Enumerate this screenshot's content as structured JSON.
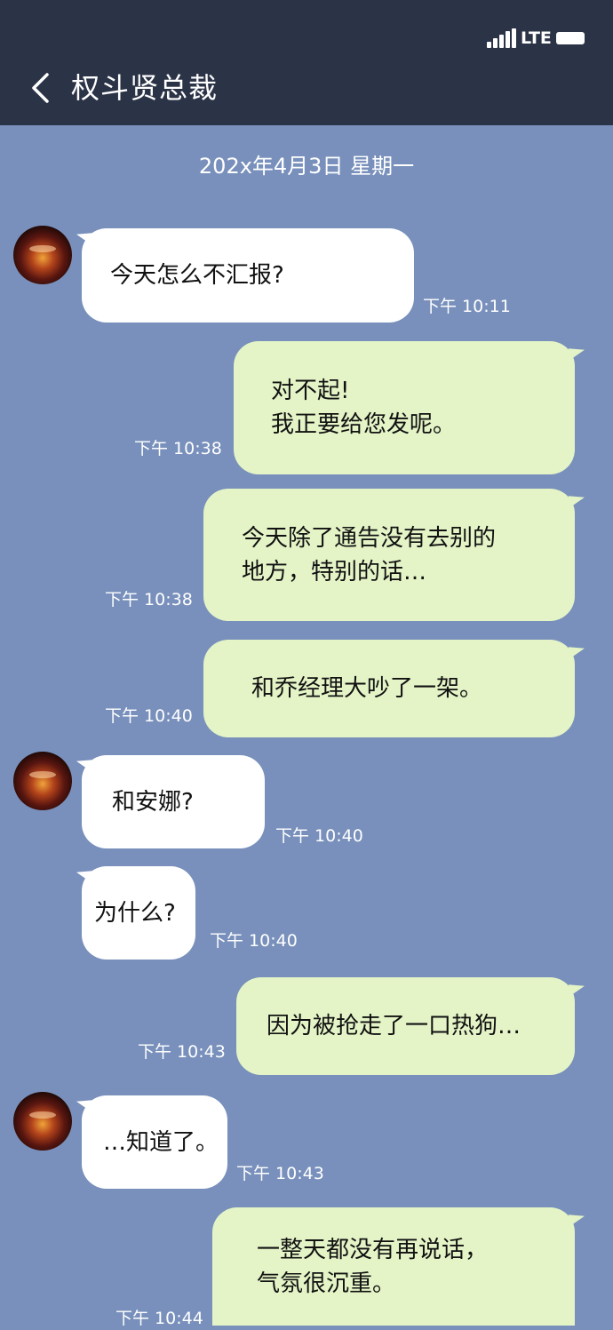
{
  "status_bar": {
    "network": "LTE"
  },
  "header": {
    "title": "权斗贤总裁"
  },
  "date_separator": "202x年4月3日 星期一",
  "messages": [
    {
      "direction": "in",
      "text": "今天怎么不汇报?",
      "time": "下午 10:11"
    },
    {
      "direction": "out",
      "text": "对不起!\n我正要给您发呢。",
      "time": "下午 10:38"
    },
    {
      "direction": "out",
      "text": "今天除了通告没有去别的\n地方，特别的话…",
      "time": "下午 10:38"
    },
    {
      "direction": "out",
      "text": "和乔经理大吵了一架。",
      "time": "下午 10:40"
    },
    {
      "direction": "in",
      "text": "和安娜?",
      "time": "下午 10:40"
    },
    {
      "direction": "in",
      "text": "为什么?",
      "time": "下午 10:40"
    },
    {
      "direction": "out",
      "text": "因为被抢走了一口热狗…",
      "time": "下午 10:43"
    },
    {
      "direction": "in",
      "text": "…知道了。",
      "time": "下午 10:43"
    },
    {
      "direction": "out",
      "text": "一整天都没有再说话，\n气氛很沉重。",
      "time": "下午 10:44"
    }
  ],
  "colors": {
    "header_bg": "#2b3347",
    "chat_bg": "#7890bb",
    "incoming_bubble": "#ffffff",
    "outgoing_bubble": "#e4f4c7"
  },
  "icons": [
    "back-chevron-icon",
    "signal-icon",
    "battery-icon",
    "contact-avatar"
  ]
}
